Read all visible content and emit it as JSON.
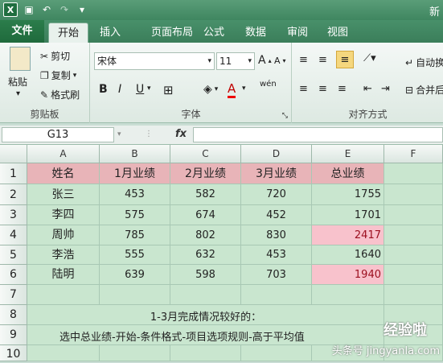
{
  "window": {
    "title": "新"
  },
  "tabs": [
    {
      "label": "文件"
    },
    {
      "label": "开始"
    },
    {
      "label": "插入"
    },
    {
      "label": "页面布局"
    },
    {
      "label": "公式"
    },
    {
      "label": "数据"
    },
    {
      "label": "审阅"
    },
    {
      "label": "视图"
    }
  ],
  "ribbon": {
    "clipboard": {
      "paste": "粘贴",
      "cut": "剪切",
      "copy": "复制",
      "format_painter": "格式刷",
      "label": "剪贴板"
    },
    "font": {
      "name": "宋体",
      "size": "11",
      "label": "字体",
      "bold": "B",
      "italic": "I",
      "underline": "U"
    },
    "alignment": {
      "wrap": "自动换",
      "merge": "合并后",
      "label": "对齐方式"
    }
  },
  "formula_bar": {
    "name_box": "G13",
    "fx": "fx",
    "value": ""
  },
  "columns": [
    "A",
    "B",
    "C",
    "D",
    "E",
    "F"
  ],
  "rows": [
    "1",
    "2",
    "3",
    "4",
    "5",
    "6",
    "7",
    "8",
    "9",
    "10"
  ],
  "headers": [
    "姓名",
    "1月业绩",
    "2月业绩",
    "3月业绩",
    "总业绩"
  ],
  "data": [
    {
      "name": "张三",
      "m1": "453",
      "m2": "582",
      "m3": "720",
      "total": "1755"
    },
    {
      "name": "李四",
      "m1": "575",
      "m2": "674",
      "m3": "452",
      "total": "1701"
    },
    {
      "name": "周帅",
      "m1": "785",
      "m2": "802",
      "m3": "830",
      "total": "2417"
    },
    {
      "name": "李浩",
      "m1": "555",
      "m2": "632",
      "m3": "453",
      "total": "1640"
    },
    {
      "name": "陆明",
      "m1": "639",
      "m2": "598",
      "m3": "703",
      "total": "1940"
    }
  ],
  "highlighted_totals": [
    "2417",
    "1940"
  ],
  "colors": {
    "accent": "#3f8660",
    "highlight_fill": "#f8c2cc",
    "highlight_text": "#9c1020",
    "header_fill": "#e8b4b8",
    "cell_fill": "#c9e6cf"
  },
  "notes": {
    "row8": "1-3月完成情况较好的：",
    "row9": "选中总业绩-开始-条件格式-项目选项规则-高于平均值"
  },
  "watermark": {
    "main": "经验啦",
    "sub": "头条号 jingyanla.com"
  }
}
